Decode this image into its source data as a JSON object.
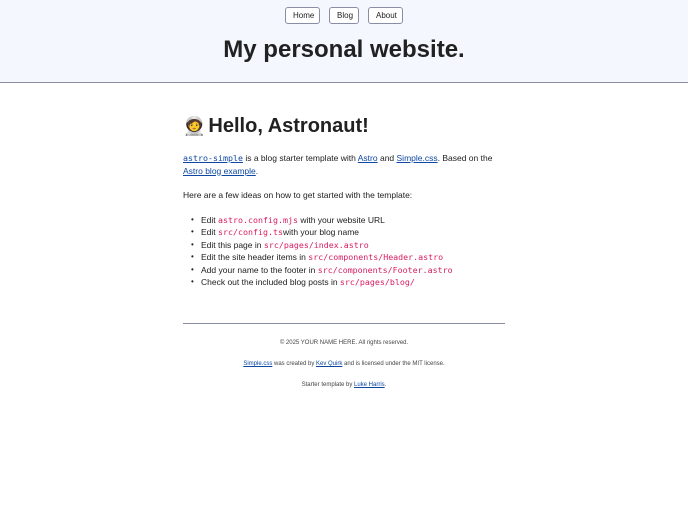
{
  "nav": {
    "items": [
      {
        "label": "Home"
      },
      {
        "label": "Blog"
      },
      {
        "label": "About"
      }
    ]
  },
  "header": {
    "title": "My personal website."
  },
  "main": {
    "heading_emoji": "🧑‍🚀",
    "heading": "Hello, Astronaut!",
    "intro": {
      "project_code": "astro-simple",
      "text1": " is a blog starter template with ",
      "link_astro": "Astro",
      "text2": " and ",
      "link_simplecss": "Simple.css",
      "text3": ". Based on the ",
      "link_example": "Astro blog example",
      "text4": "."
    },
    "ideas_lead": "Here are a few ideas on how to get started with the template:",
    "ideas": [
      {
        "prefix": "Edit ",
        "code": "astro.config.mjs",
        "suffix": " with your website URL"
      },
      {
        "prefix": "Edit ",
        "code": "src/config.ts",
        "suffix": "with your blog name"
      },
      {
        "prefix": "Edit this page in ",
        "code": "src/pages/index.astro",
        "suffix": ""
      },
      {
        "prefix": "Edit the site header items in ",
        "code": "src/components/Header.astro",
        "suffix": ""
      },
      {
        "prefix": "Add your name to the footer in ",
        "code": "src/components/Footer.astro",
        "suffix": ""
      },
      {
        "prefix": "Check out the included blog posts in ",
        "code": "src/pages/blog/",
        "suffix": ""
      }
    ]
  },
  "footer": {
    "copyright": "© 2025 YOUR NAME HERE. All rights reserved.",
    "credit_link": "Simple.css",
    "credit_text1": " was created by ",
    "credit_author": "Kev Quirk",
    "credit_text2": " and is licensed under the MIT license.",
    "starter_text": "Starter template by ",
    "starter_author": "Luke Harris",
    "starter_end": "."
  },
  "colors": {
    "header_bg": "#f5f7ff",
    "text": "#212121",
    "link": "#0d47a1",
    "code": "#d81b60",
    "border": "#898EA4"
  }
}
